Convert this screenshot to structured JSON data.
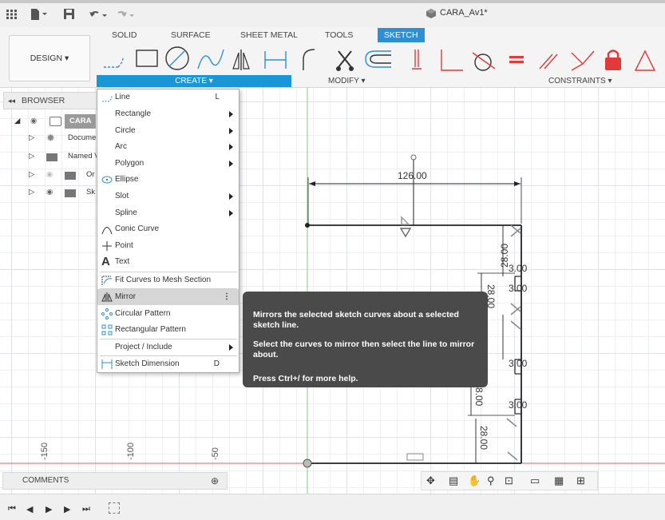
{
  "app": {
    "title": "CARA_Av1*"
  },
  "toolbar_tabs": [
    {
      "label": "SOLID"
    },
    {
      "label": "SURFACE"
    },
    {
      "label": "SHEET METAL"
    },
    {
      "label": "TOOLS"
    },
    {
      "label": "SKETCH"
    }
  ],
  "workspace": {
    "design_label": "DESIGN ▾"
  },
  "groups": {
    "create": "CREATE ▾",
    "modify": "MODIFY ▾",
    "constraints": "CONSTRAINTS ▾"
  },
  "browser": {
    "header": "BROWSER",
    "items": [
      {
        "label": "CARA"
      },
      {
        "label": "Docume"
      },
      {
        "label": "Named V"
      },
      {
        "label": "Or"
      },
      {
        "label": "Sk"
      }
    ]
  },
  "create_menu": {
    "items": [
      {
        "label": "Line",
        "shortcut": "L"
      },
      {
        "label": "Rectangle"
      },
      {
        "label": "Circle"
      },
      {
        "label": "Arc"
      },
      {
        "label": "Polygon"
      },
      {
        "label": "Ellipse"
      },
      {
        "label": "Slot"
      },
      {
        "label": "Spline"
      },
      {
        "label": "Conic Curve"
      },
      {
        "label": "Point"
      },
      {
        "label": "Text"
      },
      {
        "label": "Fit Curves to Mesh Section"
      },
      {
        "label": "Mirror"
      },
      {
        "label": "Circular Pattern"
      },
      {
        "label": "Rectangular Pattern"
      },
      {
        "label": "Project / Include"
      },
      {
        "label": "Sketch Dimension",
        "shortcut": "D"
      }
    ]
  },
  "tooltip": {
    "line1": "Mirrors the selected sketch curves about a selected sketch line.",
    "line2": "Select the curves to mirror then select the line to mirror about.",
    "line3": "Press Ctrl+/ for more help."
  },
  "dimensions": {
    "top": "126.00",
    "d28a": "28.00",
    "d300a": "3.00",
    "d28b": "28.00",
    "d300b": "3.00",
    "d28c": "28.00",
    "d300c": "3.00",
    "d28d": "8.00",
    "d300d": "3.00",
    "d28e": "28.00"
  },
  "ruler": {
    "m150": "-150",
    "m100": "-100",
    "m50": "-50"
  },
  "comments": {
    "label": "COMMENTS"
  },
  "colors": {
    "accent": "#1a96d6",
    "sketch_tab": "#2d8fd6",
    "constraint_red": "#e03a3a",
    "axis_red": "#e06060",
    "axis_green": "#60c060"
  }
}
